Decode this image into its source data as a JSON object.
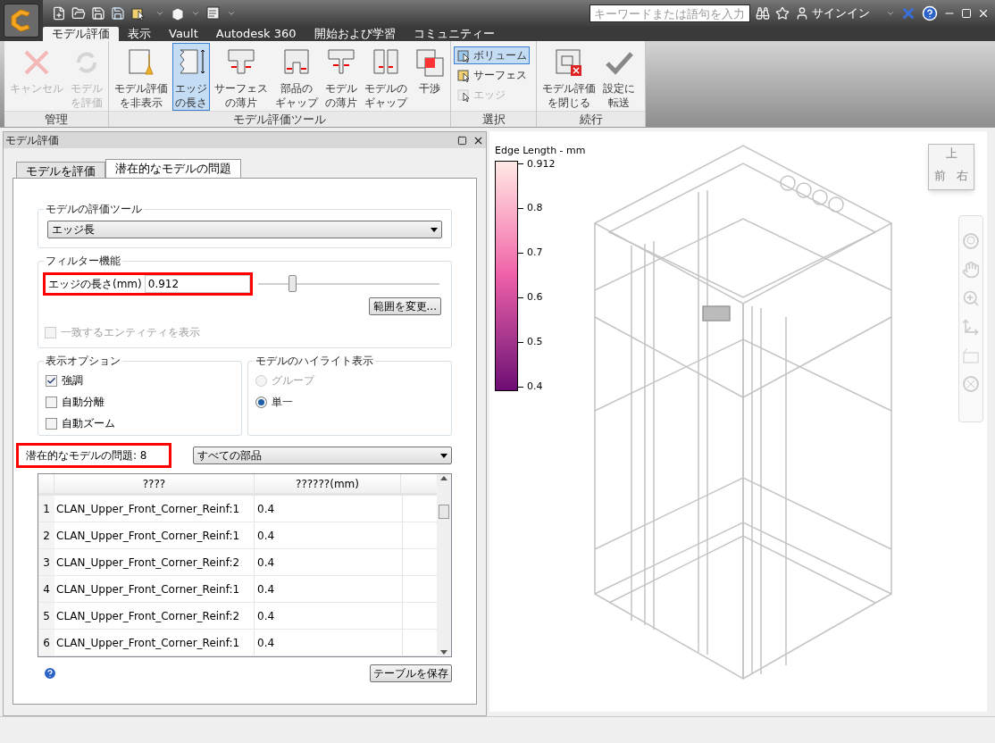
{
  "search": {
    "placeholder": "キーワードまたは語句を入力"
  },
  "sign_in": "サインイン",
  "ribbon_tabs": [
    {
      "label": "モデル評価",
      "selected": true
    },
    {
      "label": "表示",
      "selected": false
    },
    {
      "label": "Vault",
      "selected": false
    },
    {
      "label": "Autodesk 360",
      "selected": false
    },
    {
      "label": "開始および学習",
      "selected": false
    },
    {
      "label": "コミュニティー",
      "selected": false
    }
  ],
  "ribbon_groups": [
    {
      "title": "管理",
      "buttons": [
        {
          "kind": "cancel",
          "lines": [
            "キャンセル"
          ],
          "disabled": true,
          "selected": false
        },
        {
          "kind": "refresh",
          "lines": [
            "モデル",
            "を評価"
          ],
          "disabled": true,
          "selected": false
        }
      ]
    },
    {
      "title": "モデル評価ツール",
      "buttons": [
        {
          "kind": "hide",
          "lines": [
            "モデル評価",
            "を非表示"
          ],
          "disabled": false,
          "selected": false
        },
        {
          "kind": "edge",
          "lines": [
            "エッジ",
            "の長さ"
          ],
          "disabled": false,
          "selected": true
        },
        {
          "kind": "surface",
          "lines": [
            "サーフェス",
            "の薄片"
          ],
          "disabled": false,
          "selected": false
        },
        {
          "kind": "gap",
          "lines": [
            "部品の",
            "ギャップ"
          ],
          "disabled": false,
          "selected": false
        },
        {
          "kind": "thin",
          "lines": [
            "モデル",
            "の薄片"
          ],
          "disabled": false,
          "selected": false
        },
        {
          "kind": "mgap",
          "lines": [
            "モデルの",
            "ギャップ"
          ],
          "disabled": false,
          "selected": false
        },
        {
          "kind": "interfere",
          "lines": [
            "干渉"
          ],
          "disabled": false,
          "selected": false
        }
      ]
    },
    {
      "title": "選択",
      "options": [
        {
          "label": "ボリューム",
          "selected": true,
          "disabled": false
        },
        {
          "label": "サーフェス",
          "selected": false,
          "disabled": false
        },
        {
          "label": "エッジ",
          "selected": false,
          "disabled": true
        }
      ]
    },
    {
      "title": "続行",
      "buttons": [
        {
          "kind": "close",
          "lines": [
            "モデル評価",
            "を閉じる"
          ],
          "disabled": false,
          "selected": false
        },
        {
          "kind": "check",
          "lines": [
            "設定に",
            "転送"
          ],
          "disabled": false,
          "selected": false
        }
      ]
    }
  ],
  "panel": {
    "title": "モデル評価",
    "tabs": [
      {
        "label": "モデルを評価",
        "selected": false
      },
      {
        "label": "潜在的なモデルの問題",
        "selected": true
      }
    ],
    "tool_group": {
      "title": "モデルの評価ツール",
      "value": "エッジ長"
    },
    "filter_group": {
      "title": "フィルター機能",
      "field_label": "エッジの長さ(mm)",
      "value": "0.912",
      "annotated": true,
      "slider": {
        "level": 0.19
      },
      "range_button": "範囲を変更...",
      "match_checkbox": {
        "label": "一致するエンティティを表示",
        "checked": false,
        "disabled": true
      }
    },
    "display_options": {
      "title": "表示オプション",
      "items": [
        {
          "label": "強調",
          "checked": true
        },
        {
          "label": "自動分離",
          "checked": false
        },
        {
          "label": "自動ズーム",
          "checked": false
        }
      ]
    },
    "highlight": {
      "title": "モデルのハイライト表示",
      "items": [
        {
          "label": "グループ",
          "selected": false,
          "disabled": true
        },
        {
          "label": "単一",
          "selected": true,
          "disabled": false
        }
      ]
    },
    "issues": {
      "label": "潜在的なモデルの問題: 8",
      "annotated": true,
      "filter": "すべての部品"
    },
    "table": {
      "columns": [
        "????",
        "??????(mm)"
      ],
      "rows": [
        {
          "index": "1",
          "name": "CLAN_Upper_Front_Corner_Reinf:1",
          "value": "0.4"
        },
        {
          "index": "2",
          "name": "CLAN_Upper_Front_Corner_Reinf:1",
          "value": "0.4"
        },
        {
          "index": "3",
          "name": "CLAN_Upper_Front_Corner_Reinf:2",
          "value": "0.4"
        },
        {
          "index": "4",
          "name": "CLAN_Upper_Front_Corner_Reinf:1",
          "value": "0.4"
        },
        {
          "index": "5",
          "name": "CLAN_Upper_Front_Corner_Reinf:2",
          "value": "0.4"
        },
        {
          "index": "6",
          "name": "CLAN_Upper_Front_Corner_Reinf:1",
          "value": "0.4"
        }
      ]
    },
    "save_button": "テーブルを保存"
  },
  "viewport": {
    "legend": {
      "title": "Edge Length - mm",
      "ticks": [
        "0.912",
        "0.8",
        "0.7",
        "0.6",
        "0.5",
        "0.4"
      ]
    },
    "view_cube": {
      "top": "上",
      "front": "前",
      "right": "右"
    }
  }
}
